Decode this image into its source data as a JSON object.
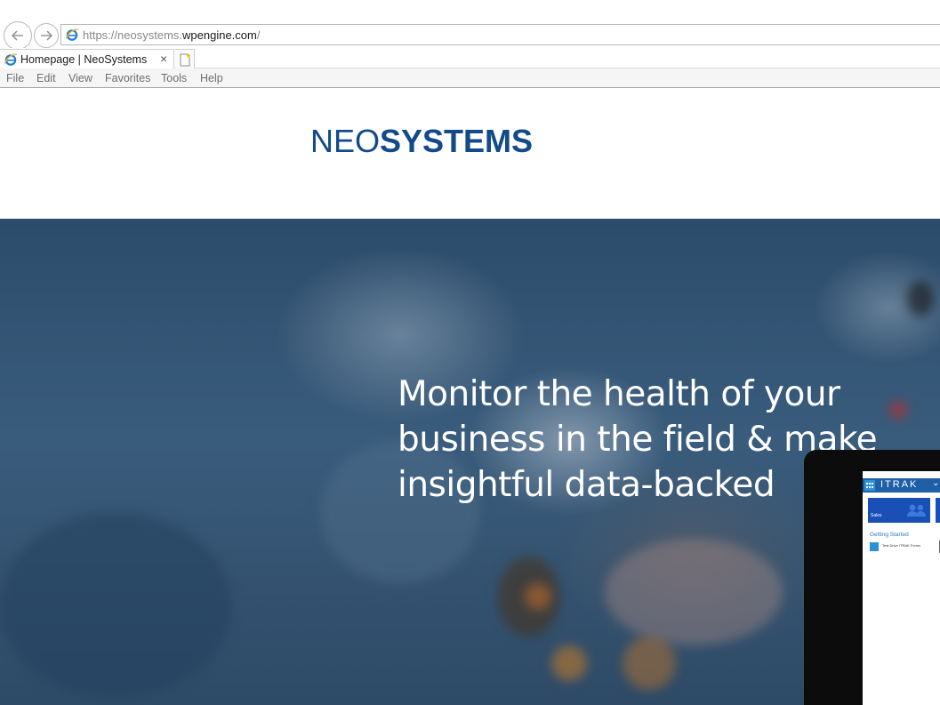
{
  "browser": {
    "url": {
      "prefix": "https://",
      "domain_pre": "neosystems.",
      "domain_hl": "wpengine.com",
      "suffix": "/"
    },
    "tab": {
      "title": "Homepage | NeoSystems",
      "close_glyph": "×"
    },
    "menu": [
      "File",
      "Edit",
      "View",
      "Favorites",
      "Tools",
      "Help"
    ]
  },
  "site": {
    "logo": {
      "neo": "NEO",
      "systems": "SYSTEMS"
    },
    "hero": {
      "headline_lines": [
        "Monitor the health of your",
        "business in the field & make",
        "insightful data-backed"
      ]
    },
    "tablet": {
      "app_title": "ITRAK",
      "chevron": "⌄",
      "tile_label": "Sales",
      "section_title": "Getting Started",
      "item_label": "Test Drive ITRAK Forms"
    }
  },
  "colors": {
    "brand_blue": "#124a8a",
    "hero_overlay": "#34546f",
    "itrak_bar": "#1e5fa8"
  }
}
